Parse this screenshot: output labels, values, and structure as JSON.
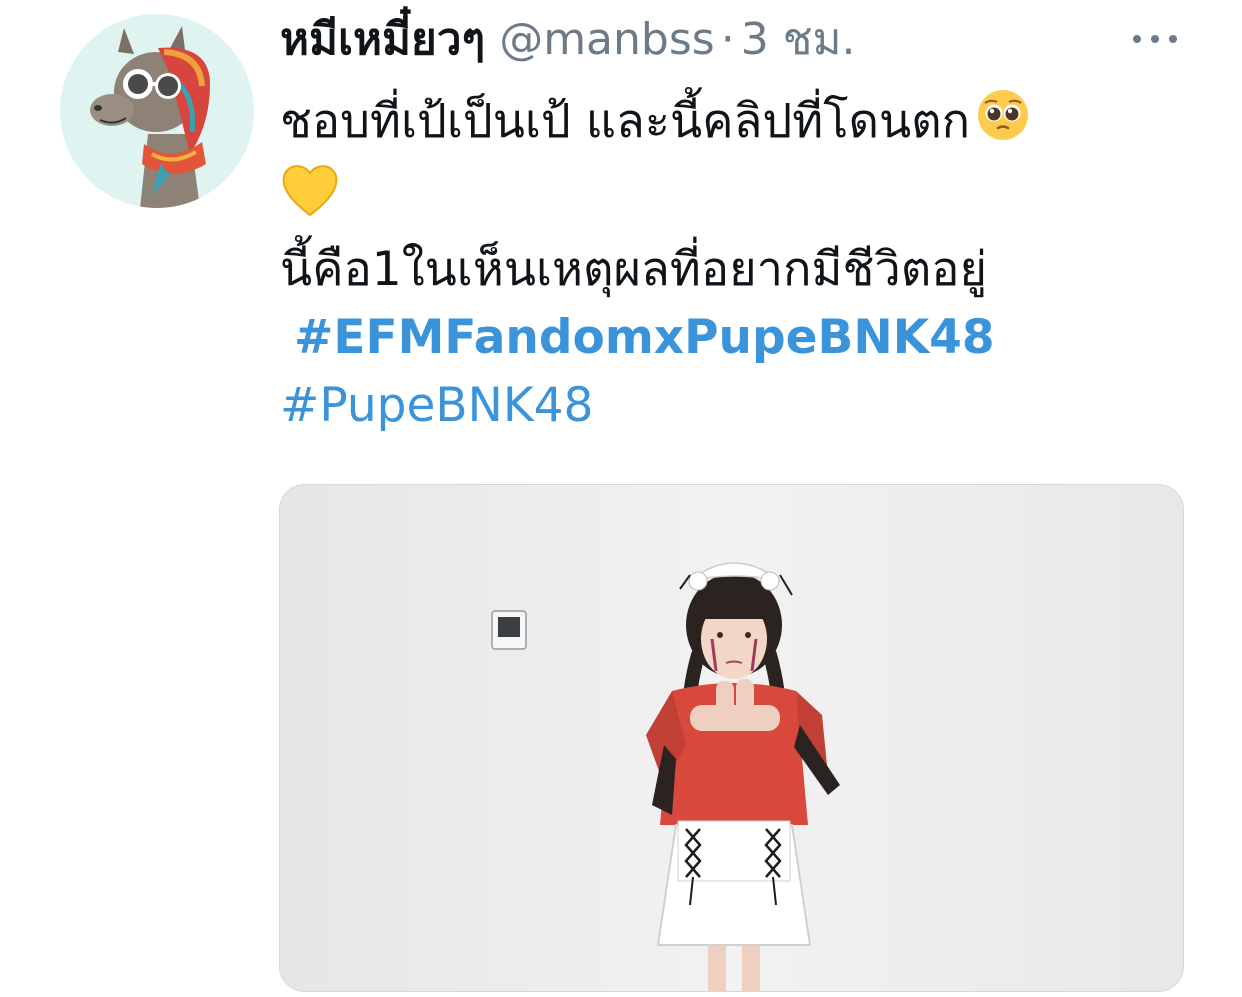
{
  "tweet": {
    "display_name": "หมีเหมี๋ยวๆ",
    "handle": "@manbss",
    "separator": "·",
    "time": "3 ชม.",
    "text_line1": "ชอบที่เป้เป็นเป้ และนี้คลิปที่โดนตก",
    "text_line3": "นี้คือ1ในเห็นเหตุผลที่อยากมีชีวิตอยู่",
    "hashtag1": "#EFMFandomxPupeBNK48",
    "hashtag2": "#PupeBNK48",
    "emoji1": "pleading-face-emoji",
    "emoji2": "yellow-heart-emoji",
    "link_color": "#3b94d9",
    "meta_color": "#6b7b8a"
  }
}
